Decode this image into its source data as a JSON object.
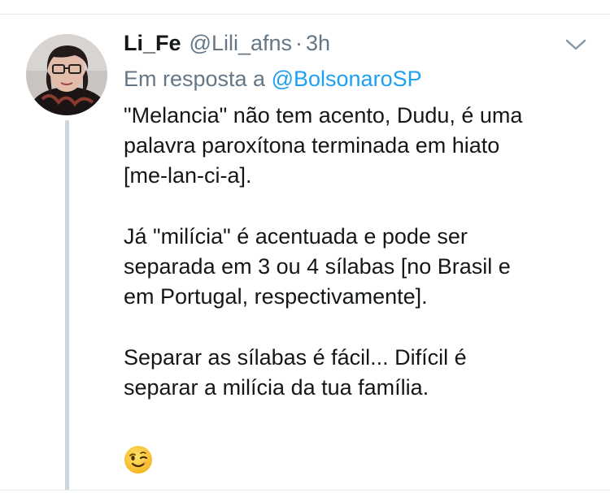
{
  "tweet": {
    "display_name": "Li_Fe",
    "handle": "@Lili_afns",
    "separator": "·",
    "time": "3h",
    "reply_prefix": "Em resposta a",
    "reply_handle": "@BolsonaroSP",
    "paragraphs": [
      [
        "\"Melancia\" não tem acento, Dudu, é uma",
        "palavra paroxítona terminada em hiato",
        "[me-lan-ci-a]."
      ],
      [
        "Já \"milícia\" é acentuada e pode ser",
        "separada em 3 ou 4 sílabas [no Brasil e",
        "em Portugal, respectivamente]."
      ],
      [
        "Separar as sílabas é fácil... Difícil é",
        "separar a milícia da tua família."
      ]
    ],
    "emoji": "winking-face-emoji"
  },
  "icons": {
    "menu": "chevron-down-icon",
    "avatar": "user-avatar"
  },
  "colors": {
    "link": "#1da1f2",
    "secondary_text": "#657786",
    "primary_text": "#14171a",
    "thread_line": "#ccd6dd"
  }
}
